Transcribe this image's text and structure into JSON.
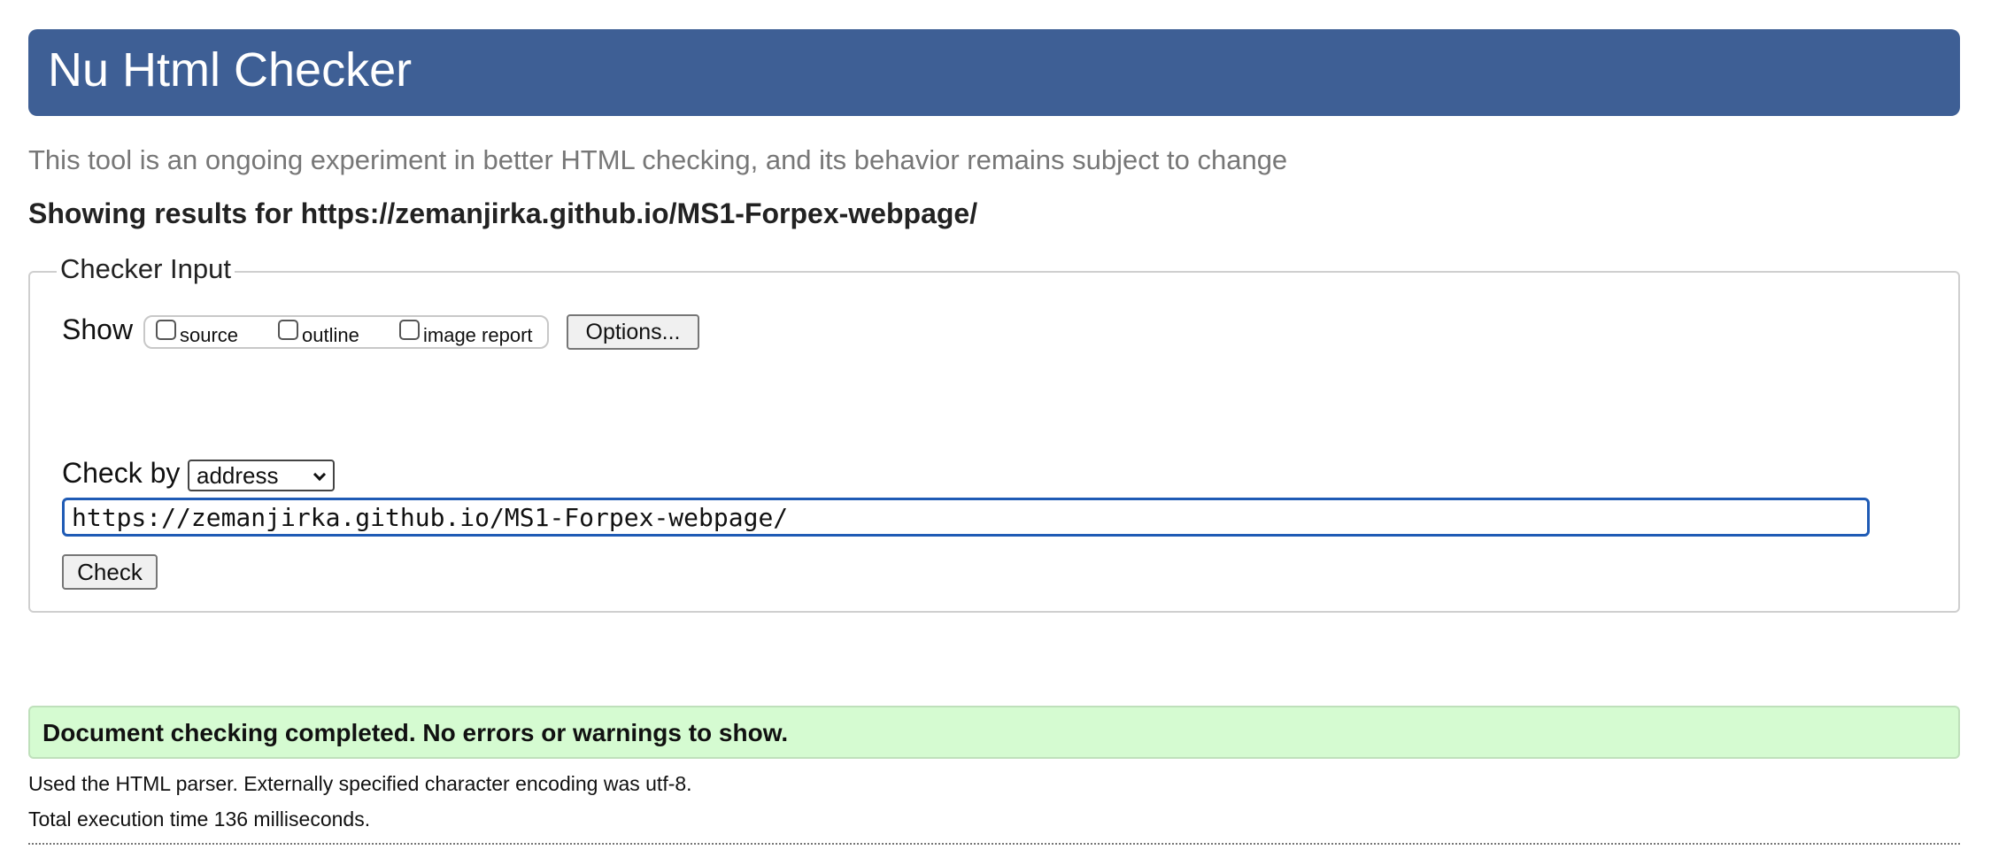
{
  "header": {
    "title": "Nu Html Checker"
  },
  "subtitle": "This tool is an ongoing experiment in better HTML checking, and its behavior remains subject to change",
  "results_heading": "Showing results for https://zemanjirka.github.io/MS1-Forpex-webpage/",
  "checker_input": {
    "legend": "Checker Input",
    "show_label": "Show",
    "show_options": [
      {
        "label": "source",
        "checked": false
      },
      {
        "label": "outline",
        "checked": false
      },
      {
        "label": "image report",
        "checked": false
      }
    ],
    "options_button": "Options...",
    "check_by_label": "Check by",
    "check_by_value": "address",
    "url_value": "https://zemanjirka.github.io/MS1-Forpex-webpage/",
    "check_button": "Check"
  },
  "result": {
    "message": "Document checking completed. No errors or warnings to show.",
    "parser_info": "Used the HTML parser. Externally specified character encoding was utf-8.",
    "execution_time": "Total execution time 136 milliseconds."
  },
  "colors": {
    "banner": "#3e5f95",
    "success_bg": "#d5fbd1",
    "input_focus": "#1f5bb5"
  }
}
